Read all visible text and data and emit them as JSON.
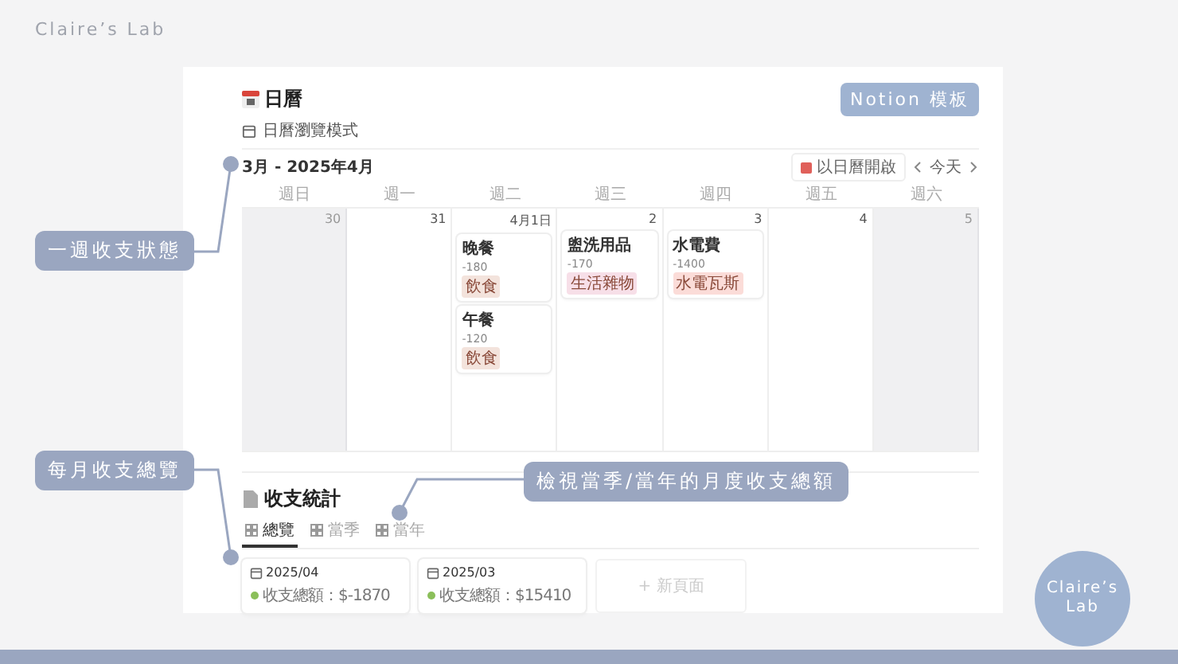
{
  "brand": "Claire’s Lab",
  "badge": "Notion 模板",
  "calendar": {
    "title": "日曆",
    "view": "日曆瀏覽模式",
    "range": "3月 - 2025年4月",
    "open_button": "以日曆開啟",
    "today_button": "今天",
    "weekdays": [
      "週日",
      "週一",
      "週二",
      "週三",
      "週四",
      "週五",
      "週六"
    ],
    "days": [
      {
        "date": "30",
        "weekend": true
      },
      {
        "date": "31",
        "weekend": false
      },
      {
        "date": "4月1日",
        "weekend": false,
        "events": [
          {
            "title": "晚餐",
            "amount": "-180",
            "tag": "飲食",
            "color": "#f3e3dc"
          },
          {
            "title": "午餐",
            "amount": "-120",
            "tag": "飲食",
            "color": "#f3e3dc"
          }
        ]
      },
      {
        "date": "2",
        "weekend": false,
        "events": [
          {
            "title": "盥洗用品",
            "amount": "-170",
            "tag": "生活雜物",
            "color": "#f7dfe8"
          }
        ]
      },
      {
        "date": "3",
        "weekend": false,
        "events": [
          {
            "title": "水電費",
            "amount": "-1400",
            "tag": "水電瓦斯",
            "color": "#fbdcd8"
          }
        ]
      },
      {
        "date": "4",
        "weekend": false
      },
      {
        "date": "5",
        "weekend": true
      }
    ]
  },
  "stats": {
    "title": "收支統計",
    "tabs": [
      {
        "label": "總覽",
        "selected": true
      },
      {
        "label": "當季",
        "selected": false
      },
      {
        "label": "當年",
        "selected": false
      }
    ],
    "cards": [
      {
        "title": "2025/04",
        "total": "收支總額：$-1870"
      },
      {
        "title": "2025/03",
        "total": "收支總額：$15410"
      }
    ],
    "new_page": "+ 新頁面"
  },
  "callouts": [
    "一週收支狀態",
    "每月收支總覽",
    "檢視當季/當年的月度收支總額"
  ],
  "logo": [
    "Claire’s",
    "Lab"
  ]
}
